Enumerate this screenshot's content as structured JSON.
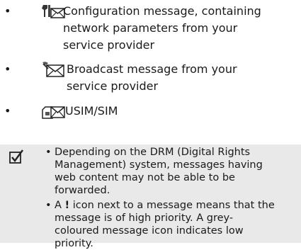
{
  "list": {
    "items": [
      {
        "icon": "configuration-message-icon",
        "lines": [
          "Configuration message, containing",
          "network parameters from your",
          "service provider"
        ]
      },
      {
        "icon": "broadcast-message-icon",
        "lines": [
          "Broadcast message from your",
          "service provider"
        ]
      },
      {
        "icon": "usim-sim-message-icon",
        "lines": [
          "USIM/SIM"
        ]
      }
    ],
    "bullet": "•"
  },
  "note": {
    "icon": "checkbox-note-icon",
    "items": [
      {
        "lines": [
          "Depending on the DRM (Digital Rights",
          "Management) system, messages having",
          "web content may not be able to be",
          "forwarded."
        ]
      },
      {
        "lines_1a": "A ",
        "exclaim": "!",
        "lines_1b": " icon next to a message means that the",
        "lines": [
          "message is of high priority. A grey-",
          "coloured message icon indicates low",
          "priority."
        ]
      }
    ]
  }
}
